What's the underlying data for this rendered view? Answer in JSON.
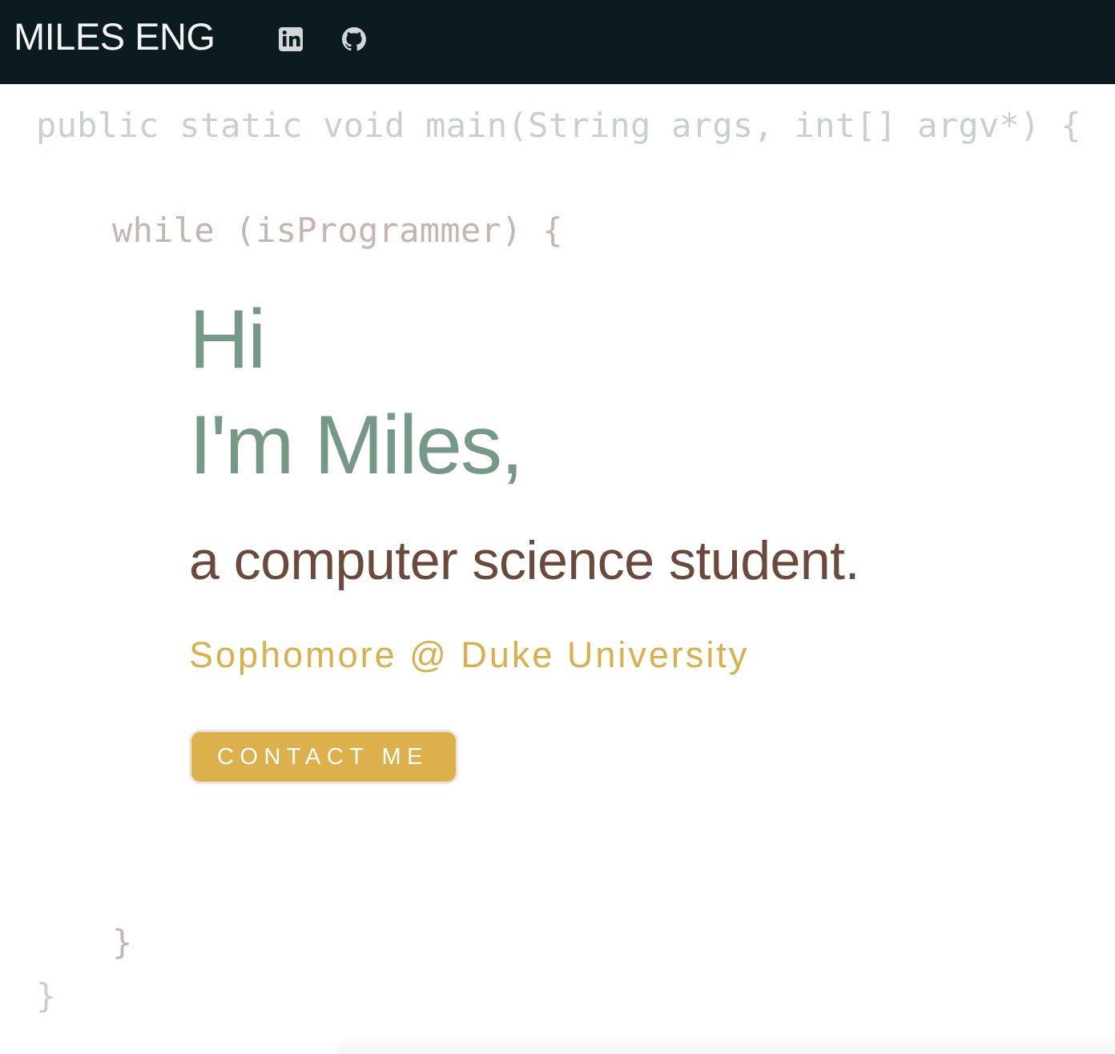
{
  "navbar": {
    "brand": "MILES ENG",
    "icons": [
      "linkedin-icon",
      "github-icon"
    ]
  },
  "code": {
    "main_signature": "public static void main(String args, int[] argv*) {",
    "while_line": "while (isProgrammer) {",
    "close_inner": "}",
    "close_outer": "}"
  },
  "hero": {
    "greeting": "Hi",
    "name_line": "I'm Miles,",
    "role": "a computer science student.",
    "school": "Sophomore @ Duke University",
    "contact_label": "CONTACT ME"
  },
  "colors": {
    "navbar_bg": "#0b1b1f",
    "heading_green": "#769886",
    "role_brown": "#6b4a3c",
    "accent_gold": "#dab04c",
    "code_main": "#c6d1cd",
    "code_while": "#c4b6ae"
  }
}
